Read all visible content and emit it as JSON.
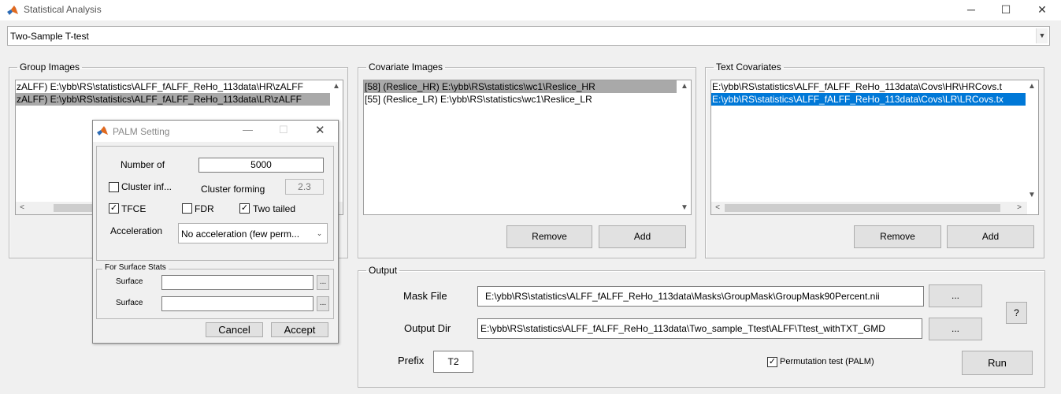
{
  "window": {
    "title": "Statistical Analysis",
    "minimize": "─",
    "maximize": "☐",
    "close": "✕"
  },
  "test_type": {
    "selected": "Two-Sample T-test"
  },
  "group_images": {
    "legend": "Group Images",
    "items": [
      "zALFF) E:\\ybb\\RS\\statistics\\ALFF_fALFF_ReHo_113data\\HR\\zALFF",
      "zALFF) E:\\ybb\\RS\\statistics\\ALFF_fALFF_ReHo_113data\\LR\\zALFF"
    ],
    "selected_index": 1
  },
  "covariate_images": {
    "legend": "Covariate Images",
    "items": [
      "[58] (Reslice_HR) E:\\ybb\\RS\\statistics\\wc1\\Reslice_HR",
      "[55] (Reslice_LR) E:\\ybb\\RS\\statistics\\wc1\\Reslice_LR"
    ],
    "selected_index": 0,
    "remove_label": "Remove",
    "add_label": "Add"
  },
  "text_covariates": {
    "legend": "Text Covariates",
    "items": [
      "E:\\ybb\\RS\\statistics\\ALFF_fALFF_ReHo_113data\\Covs\\HR\\HRCovs.t",
      "E:\\ybb\\RS\\statistics\\ALFF_fALFF_ReHo_113data\\Covs\\LR\\LRCovs.tx"
    ],
    "selected_index": 1,
    "remove_label": "Remove",
    "add_label": "Add"
  },
  "output": {
    "legend": "Output",
    "mask_label": "Mask File",
    "mask_value": "E:\\ybb\\RS\\statistics\\ALFF_fALFF_ReHo_113data\\Masks\\GroupMask\\GroupMask90Percent.nii",
    "mask_browse": "...",
    "dir_label": "Output Dir",
    "dir_value": "E:\\ybb\\RS\\statistics\\ALFF_fALFF_ReHo_113data\\Two_sample_Ttest\\ALFF\\Ttest_withTXT_GMD",
    "dir_browse": "...",
    "help_label": "?",
    "prefix_label": "Prefix",
    "prefix_value": "T2",
    "permutation_label": "Permutation test (PALM)",
    "permutation_checked": true,
    "run_label": "Run"
  },
  "palm": {
    "title": "PALM Setting",
    "number_label": "Number of",
    "number_value": "5000",
    "cluster_inf_label": "Cluster inf...",
    "cluster_inf_checked": false,
    "cluster_forming_label": "Cluster forming",
    "cluster_forming_value": "2.3",
    "tfce_label": "TFCE",
    "tfce_checked": true,
    "fdr_label": "FDR",
    "fdr_checked": false,
    "two_tailed_label": "Two tailed",
    "two_tailed_checked": true,
    "acceleration_label": "Acceleration",
    "acceleration_value": "No acceleration (few perm...",
    "surface_legend": "For Surface Stats",
    "surface1_label": "Surface",
    "surface1_value": "",
    "surface2_label": "Surface",
    "surface2_value": "",
    "browse_label": "...",
    "cancel_label": "Cancel",
    "accept_label": "Accept"
  }
}
